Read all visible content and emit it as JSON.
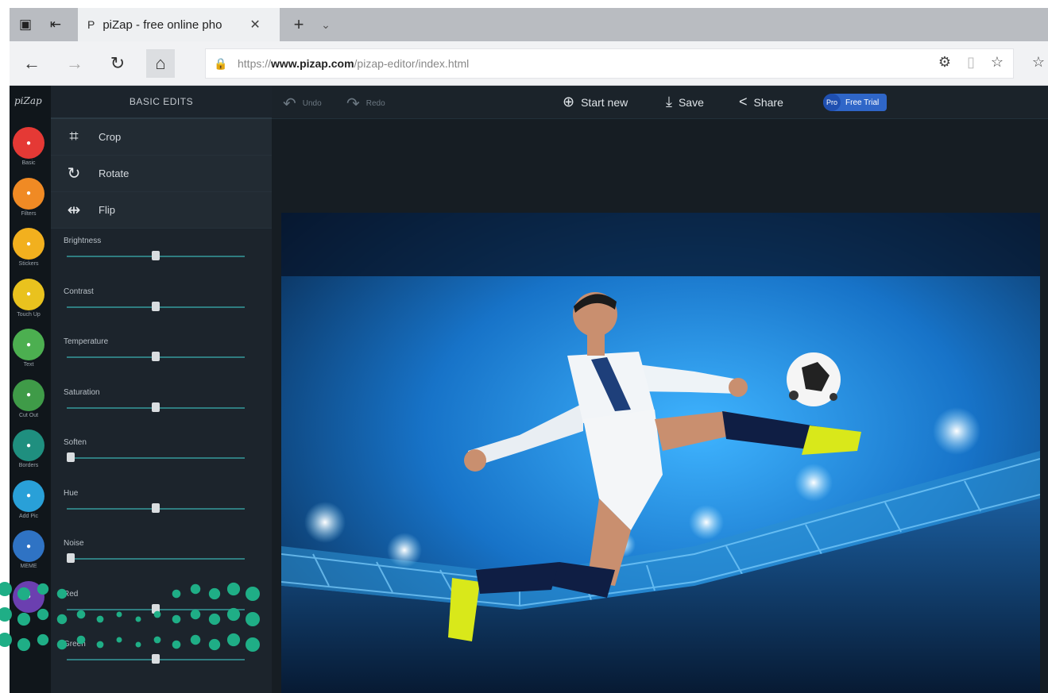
{
  "browser": {
    "tab_title": "piZap - free online pho",
    "address_url_prefix": "https://",
    "address_url_domain": "www.pizap.com",
    "address_url_path": "/pizap-editor/index.html"
  },
  "app": {
    "logo_text": "piZap",
    "panel_title": "BASIC EDITS",
    "tools": [
      {
        "label": "Crop",
        "icon": "crop-icon"
      },
      {
        "label": "Rotate",
        "icon": "rotate-icon"
      },
      {
        "label": "Flip",
        "icon": "flip-icon"
      }
    ],
    "sliders": [
      {
        "label": "Brightness",
        "value": 0.5
      },
      {
        "label": "Contrast",
        "value": 0.5
      },
      {
        "label": "Temperature",
        "value": 0.5
      },
      {
        "label": "Saturation",
        "value": 0.5
      },
      {
        "label": "Soften",
        "value": 0.0
      },
      {
        "label": "Hue",
        "value": 0.5
      },
      {
        "label": "Noise",
        "value": 0.0
      },
      {
        "label": "Red",
        "value": 0.5
      },
      {
        "label": "Green",
        "value": 0.5
      }
    ],
    "rail": [
      {
        "label": "Basic",
        "color": "#e53935",
        "icon": "basic-icon"
      },
      {
        "label": "Filters",
        "color": "#f08a24",
        "icon": "filters-icon"
      },
      {
        "label": "Stickers",
        "color": "#f2b01e",
        "icon": "stickers-icon"
      },
      {
        "label": "Touch Up",
        "color": "#e9c21e",
        "icon": "touch-up-icon"
      },
      {
        "label": "Text",
        "color": "#4caf50",
        "icon": "text-icon"
      },
      {
        "label": "Cut Out",
        "color": "#3f9b48",
        "icon": "cut-out-icon"
      },
      {
        "label": "Borders",
        "color": "#1f8f7f",
        "icon": "borders-icon"
      },
      {
        "label": "Add Pic",
        "color": "#29a0d8",
        "icon": "add-pic-icon"
      },
      {
        "label": "MEME",
        "color": "#2f73c4",
        "icon": "meme-icon"
      },
      {
        "label": "",
        "color": "#6b3fb0",
        "icon": "paint-icon"
      }
    ],
    "topbar": {
      "undo": "Undo",
      "redo": "Redo",
      "start_new": "Start new",
      "save": "Save",
      "share": "Share",
      "pro_badge": "Pro",
      "free_trial": "Free Trial"
    }
  },
  "colors": {
    "slider_track": "#2f7d80",
    "pro_blue": "#2f66c8",
    "dots": "#1fae86"
  }
}
